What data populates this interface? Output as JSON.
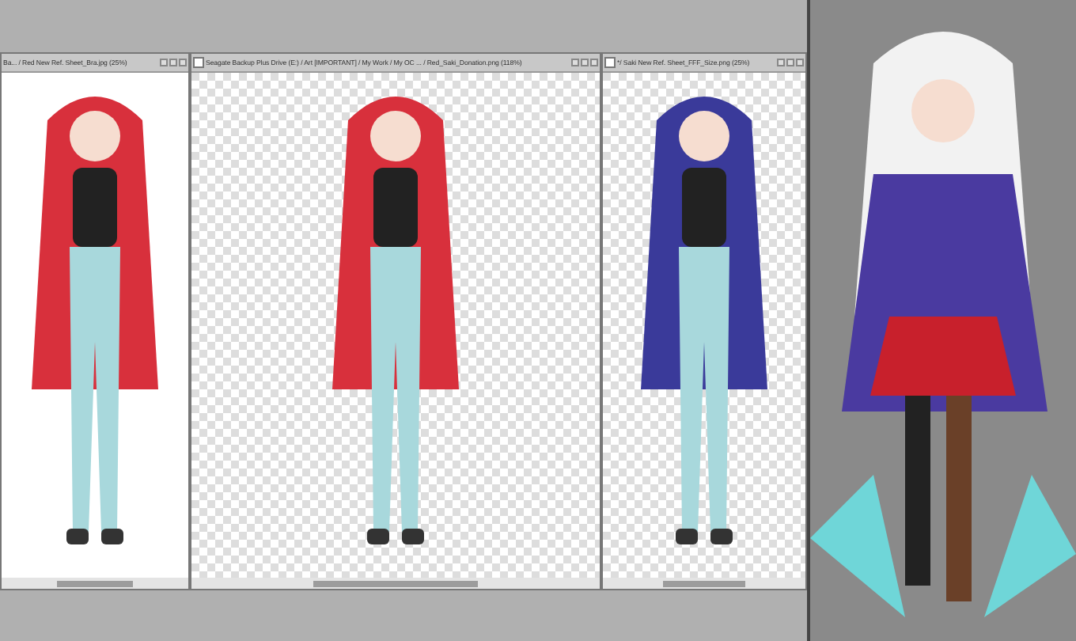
{
  "documents": [
    {
      "title": "Ba... / Red New Ref. Sheet_Bra.jpg (25%)",
      "has_icon": false
    },
    {
      "title": "Seagate Backup Plus Drive (E:) / Art [IMPORTANT] / My Work / My OC ... / Red_Saki_Donation.png (118%)",
      "has_icon": true
    },
    {
      "title": "*/ Saki New Ref. Sheet_FFF_Size.png (25%)",
      "has_icon": true
    }
  ]
}
